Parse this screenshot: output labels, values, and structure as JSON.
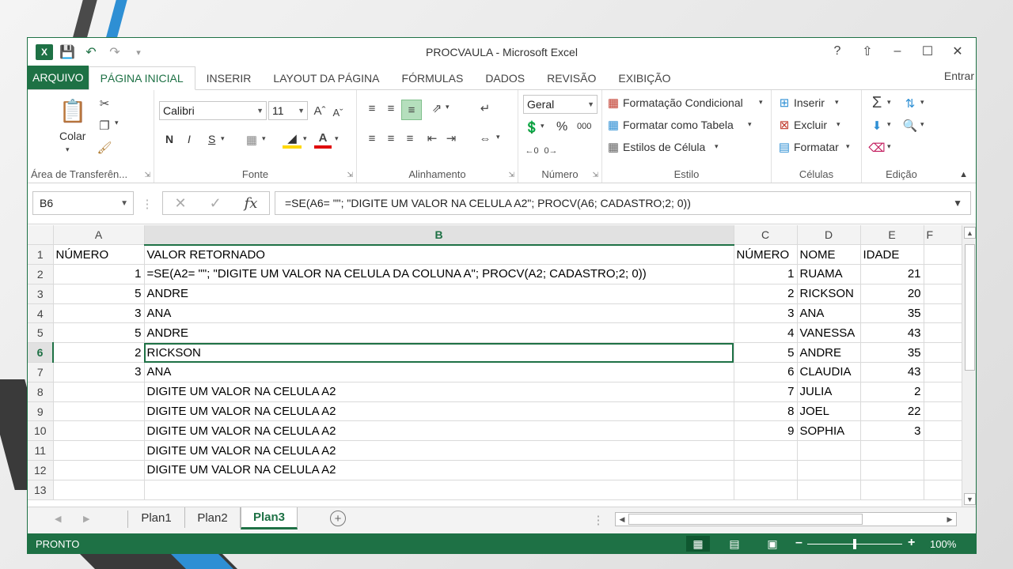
{
  "window": {
    "title": "PROCVAULA - Microsoft Excel",
    "help_label": "?",
    "user_label": "Entrar"
  },
  "tabs": [
    "ARQUIVO",
    "PÁGINA INICIAL",
    "INSERIR",
    "LAYOUT DA PÁGINA",
    "FÓRMULAS",
    "DADOS",
    "REVISÃO",
    "EXIBIÇÃO"
  ],
  "ribbon": {
    "clipboard": {
      "paste_label": "Colar",
      "group_label": "Área de Transferên..."
    },
    "font": {
      "name": "Calibri",
      "size": "11",
      "bold": "N",
      "italic": "I",
      "underline": "S",
      "group_label": "Fonte"
    },
    "alignment": {
      "group_label": "Alinhamento"
    },
    "number": {
      "format": "Geral",
      "percent": "%",
      "thousands": "000",
      "group_label": "Número"
    },
    "styles": {
      "conditional": "Formatação Condicional",
      "as_table": "Formatar como Tabela",
      "cell_styles": "Estilos de Célula",
      "group_label": "Estilo"
    },
    "cells": {
      "insert": "Inserir",
      "delete": "Excluir",
      "format": "Formatar",
      "group_label": "Células"
    },
    "editing": {
      "group_label": "Edição"
    }
  },
  "formula_bar": {
    "name_box": "B6",
    "formula": "=SE(A6= \"\"; \"DIGITE UM VALOR NA CELULA A2\"; PROCV(A6; CADASTRO;2; 0))"
  },
  "grid": {
    "columns": [
      "A",
      "B",
      "C",
      "D",
      "E",
      "F"
    ],
    "active_cell": "B6",
    "rows": [
      {
        "n": "1",
        "a": "NÚMERO",
        "b": "VALOR RETORNADO",
        "c": "NÚMERO",
        "d": "NOME",
        "e": "IDADE"
      },
      {
        "n": "2",
        "a": "1",
        "b": "=SE(A2= \"\"; \"DIGITE UM VALOR NA CELULA DA COLUNA A\"; PROCV(A2; CADASTRO;2; 0))",
        "c": "1",
        "d": "RUAMA",
        "e": "21"
      },
      {
        "n": "3",
        "a": "5",
        "b": "ANDRE",
        "c": "2",
        "d": "RICKSON",
        "e": "20"
      },
      {
        "n": "4",
        "a": "3",
        "b": "ANA",
        "c": "3",
        "d": "ANA",
        "e": "35"
      },
      {
        "n": "5",
        "a": "5",
        "b": "ANDRE",
        "c": "4",
        "d": "VANESSA",
        "e": "43"
      },
      {
        "n": "6",
        "a": "2",
        "b": "RICKSON",
        "c": "5",
        "d": "ANDRE",
        "e": "35"
      },
      {
        "n": "7",
        "a": "3",
        "b": "ANA",
        "c": "6",
        "d": "CLAUDIA",
        "e": "43"
      },
      {
        "n": "8",
        "a": "",
        "b": "DIGITE UM VALOR NA CELULA A2",
        "c": "7",
        "d": "JULIA",
        "e": "2"
      },
      {
        "n": "9",
        "a": "",
        "b": "DIGITE UM VALOR NA CELULA A2",
        "c": "8",
        "d": "JOEL",
        "e": "22"
      },
      {
        "n": "10",
        "a": "",
        "b": "DIGITE UM VALOR NA CELULA A2",
        "c": "9",
        "d": "SOPHIA",
        "e": "3"
      },
      {
        "n": "11",
        "a": "",
        "b": "DIGITE UM VALOR NA CELULA A2",
        "c": "",
        "d": "",
        "e": ""
      },
      {
        "n": "12",
        "a": "",
        "b": "DIGITE UM VALOR NA CELULA A2",
        "c": "",
        "d": "",
        "e": ""
      },
      {
        "n": "13",
        "a": "",
        "b": "",
        "c": "",
        "d": "",
        "e": ""
      }
    ]
  },
  "sheets": {
    "tabs": [
      "Plan1",
      "Plan2",
      "Plan3"
    ],
    "active": "Plan3"
  },
  "status": {
    "ready": "PRONTO",
    "zoom": "100%",
    "zoom_level": 1.0
  },
  "colors": {
    "accent": "#1e7145",
    "stripe_blue": "#2e8fd4",
    "stripe_dark": "#3a3a3a"
  }
}
